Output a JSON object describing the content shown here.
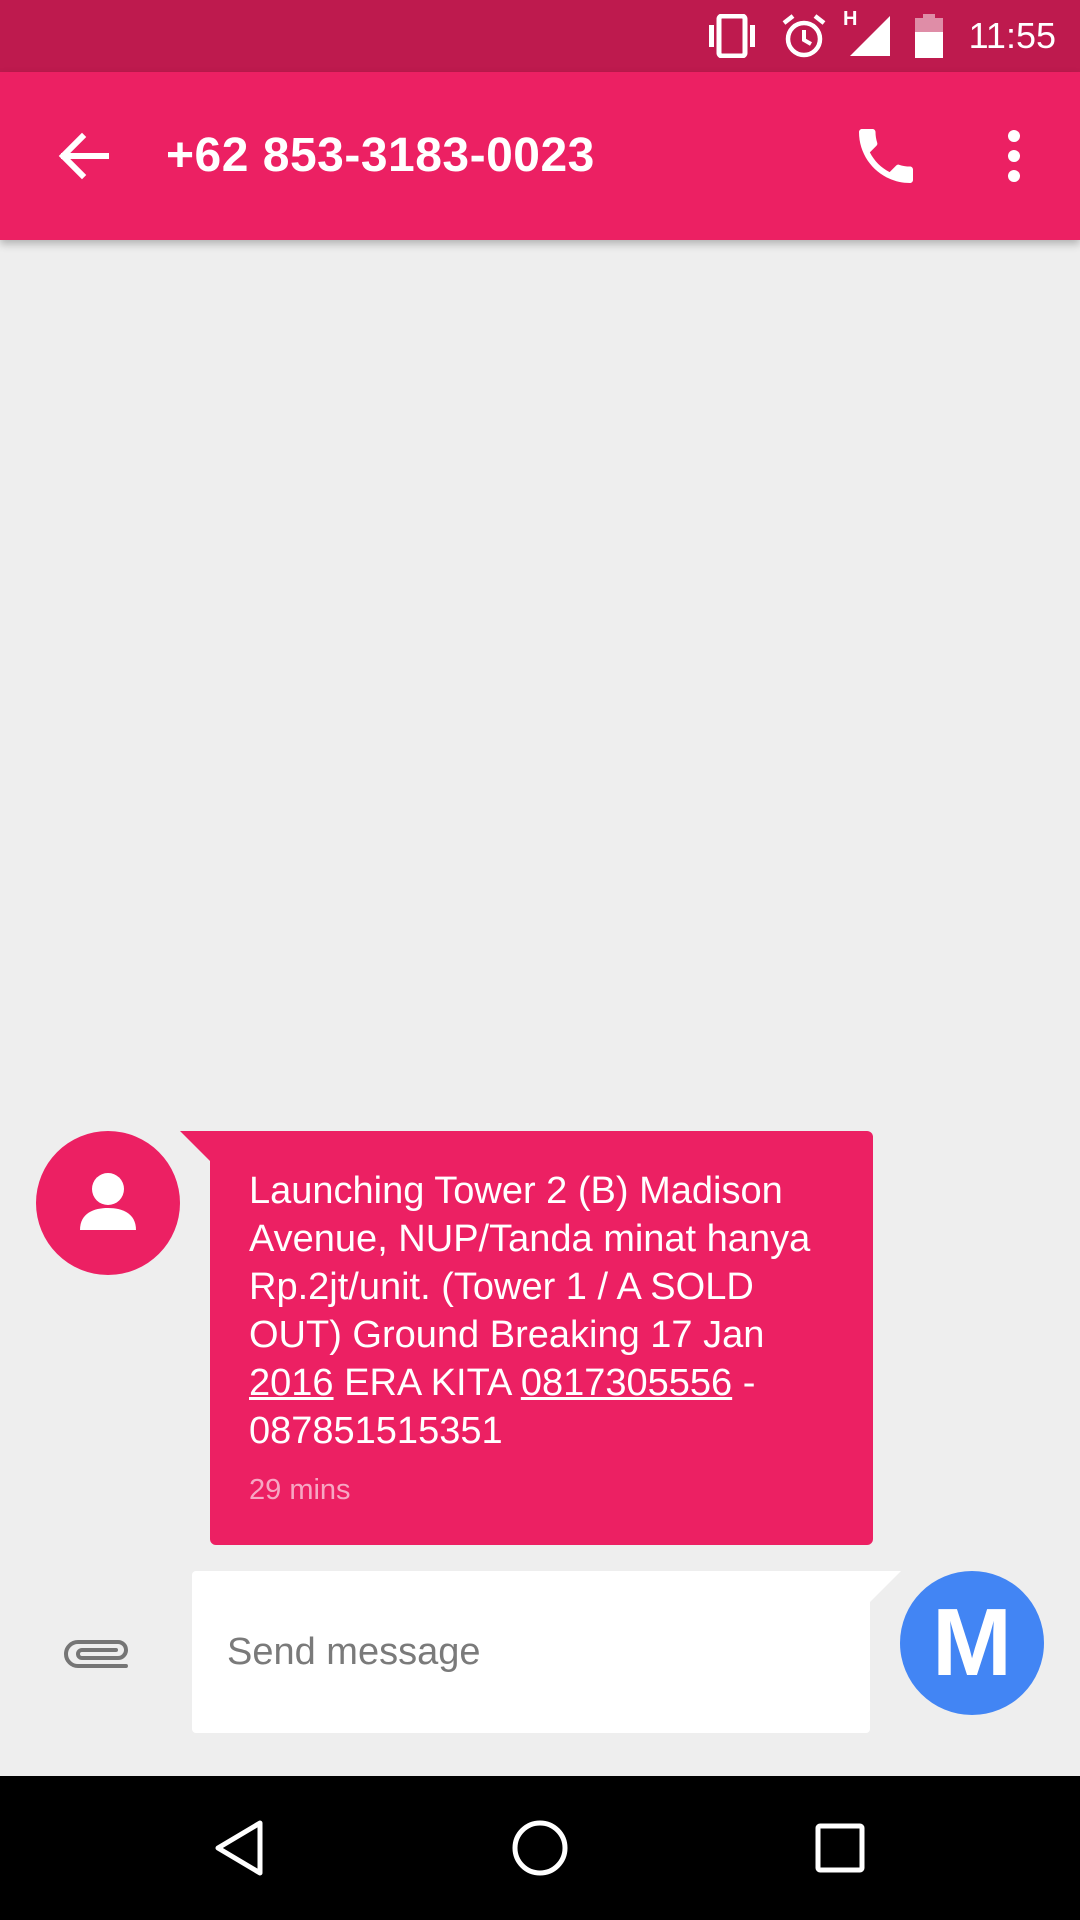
{
  "status_bar": {
    "time": "11:55",
    "network_type": "H",
    "icons": [
      "vibrate-icon",
      "alarm-icon",
      "signal-icon",
      "battery-icon"
    ]
  },
  "app_bar": {
    "title": "+62 853-3183-0023",
    "icons": [
      "back-arrow-icon",
      "phone-icon",
      "more-vert-icon"
    ]
  },
  "conversation": {
    "messages": [
      {
        "direction": "incoming",
        "text_parts": [
          "Launching Tower 2 (B) Madison Avenue, NUP/Tanda minat hanya Rp.2jt/unit. (Tower 1 / A SOLD OUT) Ground Breaking 17 Jan ",
          "2016",
          " ERA KITA ",
          "0817305556",
          " - 087851515351"
        ],
        "timestamp": "29 mins"
      }
    ]
  },
  "composer": {
    "placeholder": "Send message",
    "value": "",
    "send_label": "M"
  },
  "colors": {
    "status_bar": "#be1a4e",
    "accent": "#ec2063",
    "send_button": "#4285f4",
    "background": "#eeeeee"
  }
}
